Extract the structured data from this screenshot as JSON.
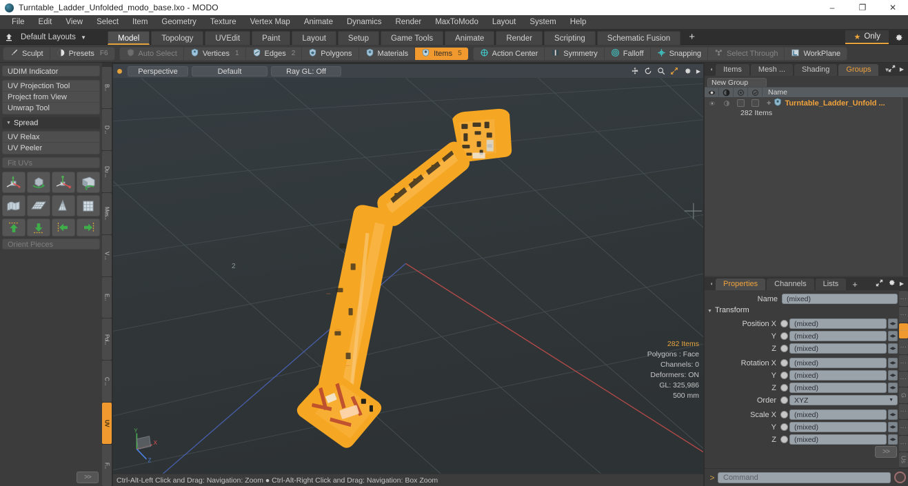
{
  "titlebar": {
    "title": "Turntable_Ladder_Unfolded_modo_base.lxo - MODO",
    "minimize": "–",
    "maximize": "❐",
    "close": "✕"
  },
  "menubar": {
    "items": [
      "File",
      "Edit",
      "View",
      "Select",
      "Item",
      "Geometry",
      "Texture",
      "Vertex Map",
      "Animate",
      "Dynamics",
      "Render",
      "MaxToModo",
      "Layout",
      "System",
      "Help"
    ]
  },
  "layoutbar": {
    "layouts_label": "Default Layouts",
    "tabs": [
      "Model",
      "Topology",
      "UVEdit",
      "Paint",
      "Layout",
      "Setup",
      "Game Tools",
      "Animate",
      "Render",
      "Scripting",
      "Schematic Fusion"
    ],
    "active_tab": "Model",
    "add_label": "+",
    "only_label": "Only",
    "star": "★"
  },
  "modebar": {
    "left_group": [
      {
        "label": "Sculpt",
        "icon": "brush-icon",
        "state": "normal",
        "num": ""
      },
      {
        "label": "Presets",
        "icon": "sphere-icon",
        "state": "normal",
        "num": "F6"
      }
    ],
    "select_group": [
      {
        "label": "Auto Select",
        "icon": "shield-icon",
        "state": "dim",
        "num": ""
      },
      {
        "label": "Vertices",
        "icon": "vertex-icon",
        "state": "normal",
        "num": "1"
      },
      {
        "label": "Edges",
        "icon": "edge-icon",
        "state": "normal",
        "num": "2"
      },
      {
        "label": "Polygons",
        "icon": "polygon-icon",
        "state": "normal",
        "num": ""
      },
      {
        "label": "Materials",
        "icon": "material-icon",
        "state": "normal",
        "num": ""
      },
      {
        "label": "Items",
        "icon": "item-icon",
        "state": "active",
        "num": "5"
      }
    ],
    "tool_group": [
      {
        "label": "Action Center",
        "icon": "crosshair-icon",
        "state": "normal"
      },
      {
        "label": "Symmetry",
        "icon": "symmetry-icon",
        "state": "normal"
      },
      {
        "label": "Falloff",
        "icon": "falloff-icon",
        "state": "normal"
      },
      {
        "label": "Snapping",
        "icon": "snapping-icon",
        "state": "normal"
      },
      {
        "label": "Select Through",
        "icon": "select-through-icon",
        "state": "dim"
      },
      {
        "label": "WorkPlane",
        "icon": "workplane-icon",
        "state": "normal"
      }
    ]
  },
  "leftpanel": {
    "udim": "UDIM Indicator",
    "uv_tools": [
      "UV Projection Tool",
      "Project from View",
      "Unwrap Tool"
    ],
    "spread_header": "Spread",
    "relax_tools": [
      "UV Relax",
      "UV Peeler"
    ],
    "fit_uvs": "Fit UVs",
    "orient_pieces": "Orient Pieces",
    "expand_label": ">>",
    "icon_row_1": [
      "uv-move-icon",
      "uv-rotate-icon",
      "uv-scale-icon",
      "uv-flip-icon"
    ],
    "icon_row_2": [
      "uv-fit-icon",
      "uv-grid-icon",
      "uv-taper-icon",
      "uv-square-icon"
    ],
    "arrow_row": [
      "arrow-up-icon",
      "arrow-down-icon",
      "arrow-left-icon",
      "arrow-right-icon"
    ],
    "vtabs": [
      "B...",
      "D ...",
      "Du ...",
      "Mes...",
      "V ...",
      "E...",
      "Pol...",
      "C ...",
      "UV",
      "F..."
    ],
    "vtab_active": "UV"
  },
  "viewport": {
    "view_mode": "Perspective",
    "shading": "Default",
    "raygl": "Ray GL: Off",
    "icons": [
      "pan-icon",
      "rotate-icon",
      "zoom-icon",
      "fit-icon",
      "settings-icon",
      "more-icon"
    ],
    "stats": [
      "282 Items",
      "Polygons : Face",
      "Channels: 0",
      "Deformers: ON",
      "GL: 325,986",
      "500 mm"
    ],
    "axis_labels": [
      "Y",
      "X",
      "Z"
    ],
    "grid_label": "2",
    "status": "Ctrl-Alt-Left Click and Drag: Navigation: Zoom ●  Ctrl-Alt-Right Click and Drag: Navigation: Box Zoom"
  },
  "rightpanel": {
    "top_tabs": [
      "Items",
      "Mesh ...",
      "Shading",
      "Groups"
    ],
    "top_active": "Groups",
    "new_group_label": "New Group",
    "list_header_name": "Name",
    "list_header_icons": [
      "eye-icon",
      "render-icon",
      "lock-icon",
      "select-icon"
    ],
    "group_item": "Turntable_Ladder_Unfold ...",
    "group_item_count": "282 Items",
    "prop_tabs": [
      "Properties",
      "Channels",
      "Lists"
    ],
    "prop_active": "Properties",
    "prop_add": "+",
    "name_label": "Name",
    "name_value": "(mixed)",
    "transform_header": "Transform",
    "transform_rows": [
      {
        "label": "Position X",
        "value": "(mixed)",
        "type": "field"
      },
      {
        "label": "Y",
        "value": "(mixed)",
        "type": "field"
      },
      {
        "label": "Z",
        "value": "(mixed)",
        "type": "field"
      },
      {
        "label": "Rotation X",
        "value": "(mixed)",
        "type": "field"
      },
      {
        "label": "Y",
        "value": "(mixed)",
        "type": "field"
      },
      {
        "label": "Z",
        "value": "(mixed)",
        "type": "field"
      },
      {
        "label": "Order",
        "value": "XYZ",
        "type": "dropdown"
      },
      {
        "label": "Scale X",
        "value": "(mixed)",
        "type": "field"
      },
      {
        "label": "Y",
        "value": "(mixed)",
        "type": "field"
      },
      {
        "label": "Z",
        "value": "(mixed)",
        "type": "field"
      }
    ],
    "expand_label": ">>",
    "command_prompt": ">",
    "command_placeholder": "Command"
  },
  "colors": {
    "accent": "#f0992e",
    "model": "#f5a623",
    "viewport_bg": "#31373b",
    "panel_bg": "#3c3c3c",
    "field_bg": "#9aa2aa"
  }
}
